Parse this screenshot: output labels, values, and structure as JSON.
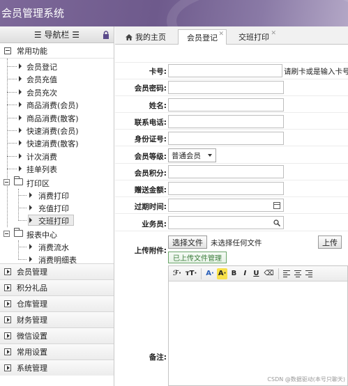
{
  "app": {
    "title": "会员管理系统"
  },
  "sidebar": {
    "nav_title": "☰ 导航栏 ☰",
    "open_group": "常用功能",
    "items": [
      "会员登记",
      "会员充值",
      "会员充次",
      "商品消费(会员)",
      "商品消费(散客)",
      "快速消费(会员)",
      "快速消费(散客)",
      "计次消费",
      "挂单列表"
    ],
    "print_folder": "打印区",
    "print_items": [
      "消费打印",
      "充值打印",
      "交班打印"
    ],
    "report_folder": "报表中心",
    "report_items": [
      "消费流水",
      "消费明细表"
    ],
    "closed_groups": [
      "会员管理",
      "积分礼品",
      "仓库管理",
      "财务管理",
      "微信设置",
      "常用设置",
      "系统管理"
    ]
  },
  "tabs": [
    {
      "label": "我的主页"
    },
    {
      "label": "会员登记"
    },
    {
      "label": "交班打印"
    }
  ],
  "form": {
    "card_label": "卡号:",
    "card_hint": "请刷卡或是输入卡号",
    "password_label": "会员密码:",
    "name_label": "姓名:",
    "phone_label": "联系电话:",
    "id_label": "身份证号:",
    "level_label": "会员等级:",
    "level_value": "普通会员",
    "points_label": "会员积分:",
    "gift_label": "赠送金额:",
    "expire_label": "过期时间:",
    "staff_label": "业务员:",
    "upload_label": "上传附件:",
    "choose_file": "选择文件",
    "no_file": "未选择任何文件",
    "upload_btn": "上传",
    "uploaded_btn": "已上传文件管理",
    "remark_label": "备注:"
  },
  "editor_toolbar": {
    "font": "ℱ·",
    "size": "тT·",
    "font_color": "A·",
    "bg_color": "A·",
    "bold": "B",
    "italic": "I",
    "underline": "U",
    "eraser": "⌫"
  },
  "watermark": "CSDN @数据驱动(本号只聊天)"
}
